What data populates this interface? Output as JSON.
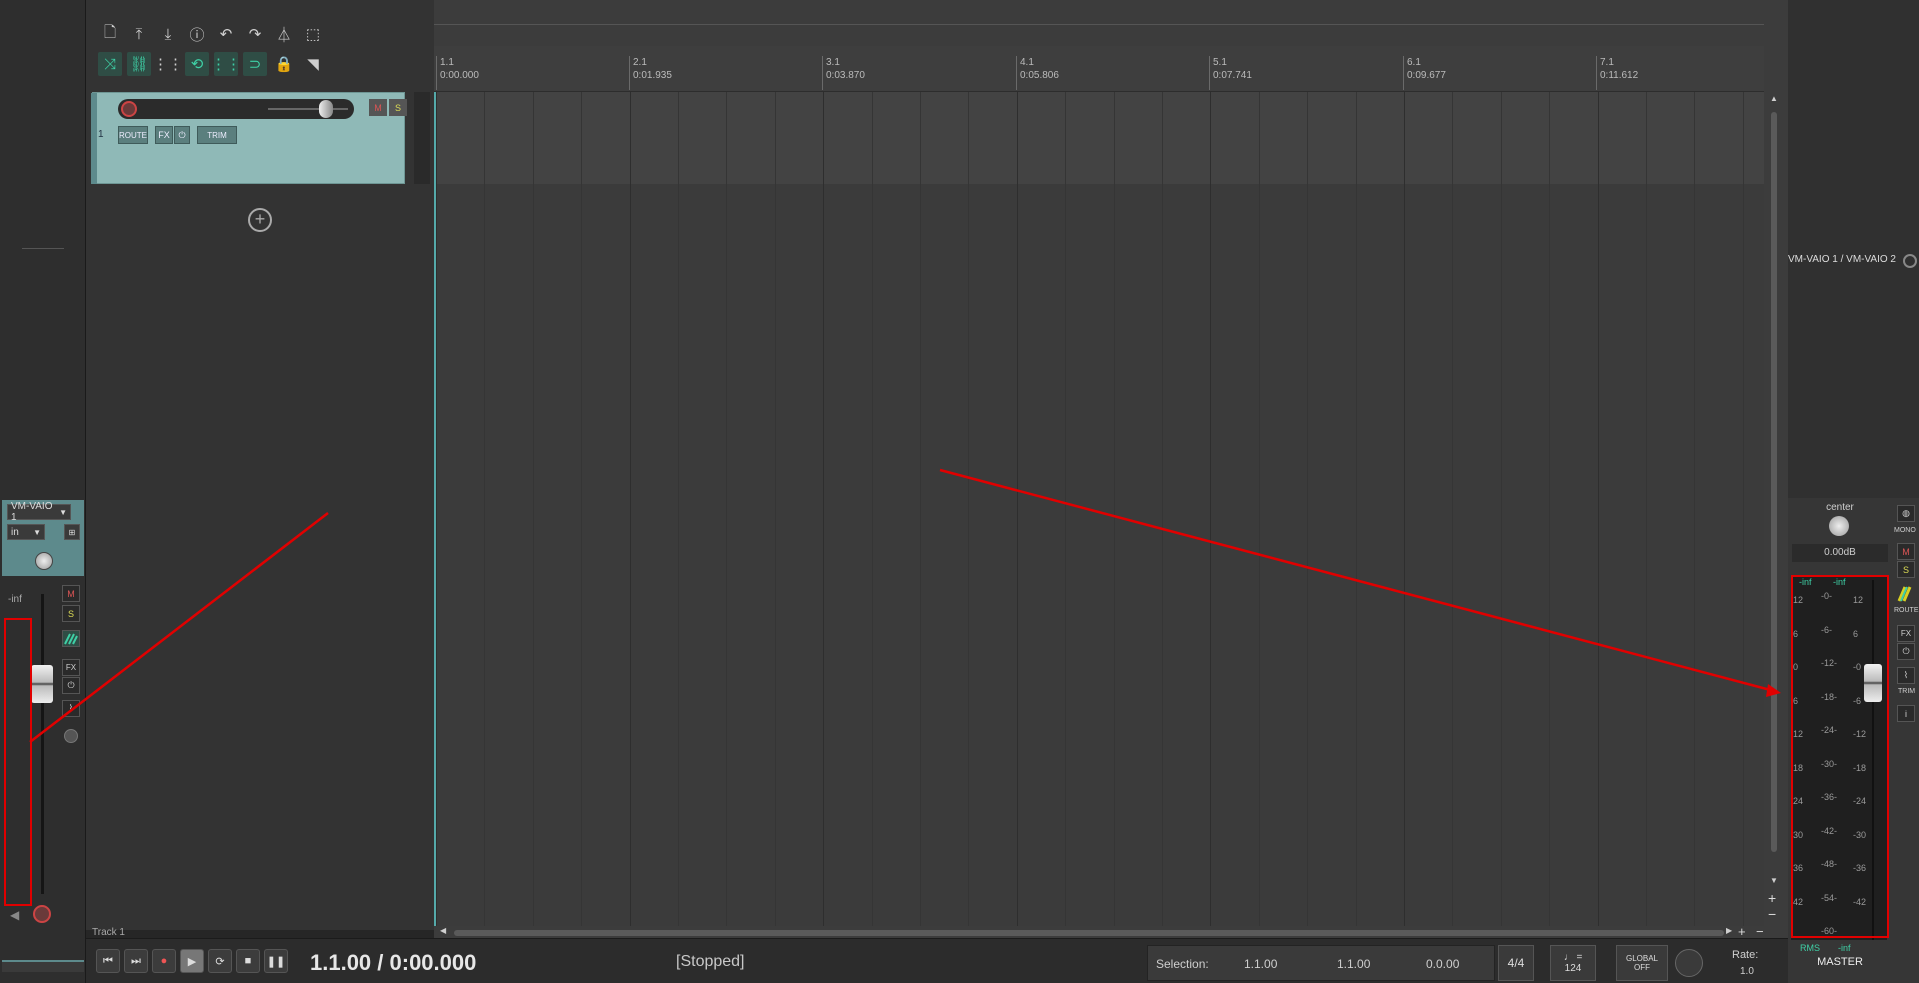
{
  "toolbar": {
    "icons": [
      "new-file-icon",
      "save-icon",
      "upload-icon",
      "info-icon",
      "undo-icon",
      "redo-icon",
      "metronome-icon",
      "selection-icon"
    ],
    "row2": [
      "ripple-icon",
      "link-icon",
      "grid-icon",
      "group-icon",
      "snap-icon",
      "loop-icon",
      "lock-icon",
      "envelope-icon"
    ]
  },
  "left_strip": {
    "input_name": "VM-VAIO 1",
    "in_label": "in",
    "level": "-inf",
    "mute": "M",
    "solo": "S",
    "fx": "FX"
  },
  "track": {
    "number": "1",
    "mute": "M",
    "solo": "S",
    "route": "ROUTE",
    "fx": "FX",
    "trim": "TRIM",
    "footer_name": "Track 1"
  },
  "ruler": {
    "marks": [
      {
        "bar": "1.1",
        "time": "0:00.000"
      },
      {
        "bar": "2.1",
        "time": "0:01.935"
      },
      {
        "bar": "3.1",
        "time": "0:03.870"
      },
      {
        "bar": "4.1",
        "time": "0:05.806"
      },
      {
        "bar": "5.1",
        "time": "0:07.741"
      },
      {
        "bar": "6.1",
        "time": "0:09.677"
      },
      {
        "bar": "7.1",
        "time": "0:11.612"
      }
    ]
  },
  "transport": {
    "position": "1.1.00 / 0:00.000",
    "status": "[Stopped]",
    "selection_label": "Selection:",
    "sel_start": "1.1.00",
    "sel_end": "1.1.00",
    "sel_len": "0.0.00",
    "time_sig": "4/4",
    "bpm_label": "♩ =",
    "bpm": "124",
    "global_label": "GLOBAL",
    "global_state": "OFF",
    "rate_label": "Rate:",
    "rate": "1.0"
  },
  "master": {
    "io": "VM-VAIO 1 / VM-VAIO 2",
    "pan": "center",
    "volume": "0.00dB",
    "peak_left": "-inf",
    "peak_right": "-inf",
    "mono": "MONO",
    "mute": "M",
    "solo": "S",
    "route": "ROUTE",
    "fx": "FX",
    "trim": "TRIM",
    "rms": "RMS",
    "rms_value": "-inf",
    "name": "MASTER",
    "scale_outer": [
      "12",
      "6",
      "0",
      "6",
      "12",
      "18",
      "24",
      "30",
      "36",
      "42"
    ],
    "scale_inner": [
      "-0-",
      "-6-",
      "-12-",
      "-18-",
      "-24-",
      "-30-",
      "-36-",
      "-42-",
      "-48-",
      "-54-",
      "-60-"
    ],
    "scale_right": [
      "12",
      "6",
      "-0",
      "-6",
      "-12",
      "-18",
      "-24",
      "-30",
      "-36",
      "-42"
    ]
  },
  "colors": {
    "annotation": "#e10000",
    "accent": "#3fd0a6",
    "track": "#8fb9b7"
  }
}
